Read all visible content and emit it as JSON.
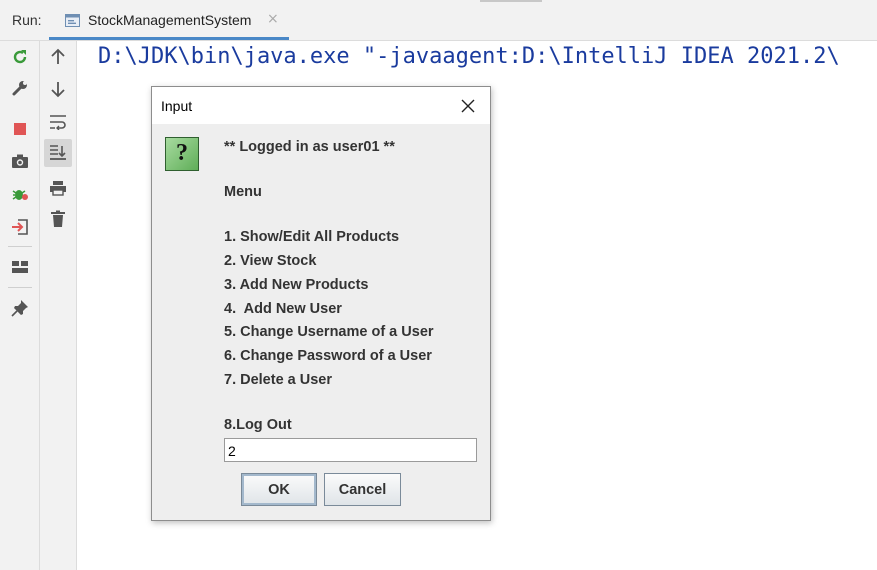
{
  "run_panel": {
    "label": "Run:",
    "tab_title": "StockManagementSystem",
    "tab_close": "×"
  },
  "console": {
    "first_line": "D:\\JDK\\bin\\java.exe \"-javaagent:D:\\IntelliJ IDEA 2021.2\\"
  },
  "toolbar_left": [
    {
      "icon": "rerun-icon",
      "color": "#3a9a3a"
    },
    {
      "icon": "wrench-icon",
      "color": "#555555"
    },
    {
      "icon": "stop-icon",
      "color": "#e05555"
    },
    {
      "icon": "camera-icon",
      "color": "#555555"
    },
    {
      "icon": "debug-bug-icon",
      "color": "#3a9a3a"
    },
    {
      "icon": "exit-icon",
      "color": "#e05555"
    },
    {
      "icon": "layout-icon",
      "color": "#555555"
    },
    {
      "icon": "pin-icon",
      "color": "#555555"
    }
  ],
  "toolbar_right": [
    {
      "icon": "arrow-up-icon"
    },
    {
      "icon": "arrow-down-icon"
    },
    {
      "icon": "soft-wrap-icon"
    },
    {
      "icon": "scroll-to-end-icon",
      "active": true
    },
    {
      "icon": "print-icon"
    },
    {
      "icon": "trash-icon"
    }
  ],
  "dialog": {
    "title": "Input",
    "icon": "question-icon",
    "icon_glyph": "?",
    "lines": [
      "** Logged in as user01 **",
      "Menu",
      "1. Show/Edit All Products",
      "2. View Stock",
      "3. Add New Products",
      "4.  Add New User",
      "5. Change Username of a User",
      "6. Change Password of a User",
      "7. Delete a User",
      "8.Log Out"
    ],
    "input_value": "2",
    "ok_label": "OK",
    "cancel_label": "Cancel"
  }
}
